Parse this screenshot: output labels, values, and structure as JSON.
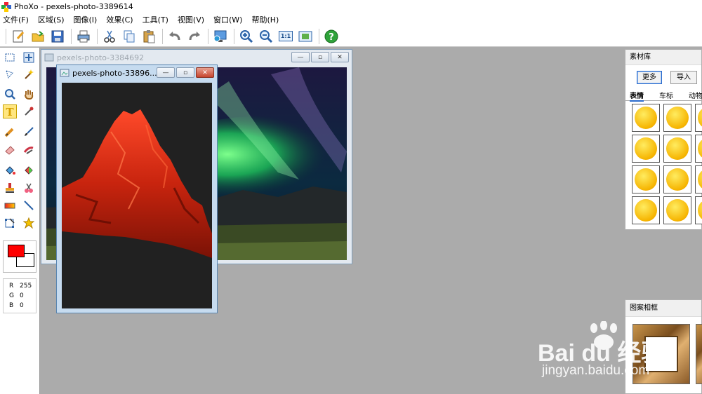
{
  "app": {
    "title": "PhoXo - pexels-photo-3389614"
  },
  "menu": [
    {
      "label": "文件(F)"
    },
    {
      "label": "区域(S)"
    },
    {
      "label": "图像(I)"
    },
    {
      "label": "效果(C)"
    },
    {
      "label": "工具(T)"
    },
    {
      "label": "视图(V)"
    },
    {
      "label": "窗口(W)"
    },
    {
      "label": "帮助(H)"
    }
  ],
  "toolbar": {
    "zoom_actual_label": "1:1"
  },
  "color": {
    "fg": "#ff0000",
    "bg": "#ffffff",
    "r_label": "R",
    "g_label": "G",
    "b_label": "B",
    "r": "255",
    "g": "0",
    "b": "0"
  },
  "windows": {
    "back": {
      "title": "pexels-photo-3384692"
    },
    "front": {
      "title": "pexels-photo-33896..."
    }
  },
  "material_panel": {
    "title": "素材库",
    "more_label": "更多",
    "import_label": "导入",
    "tabs": [
      "表情",
      "车标",
      "动物"
    ]
  },
  "frame_panel": {
    "title": "图案相框"
  },
  "watermark": {
    "brand": "Bai du 经验",
    "url": "jingyan.baidu.com"
  }
}
